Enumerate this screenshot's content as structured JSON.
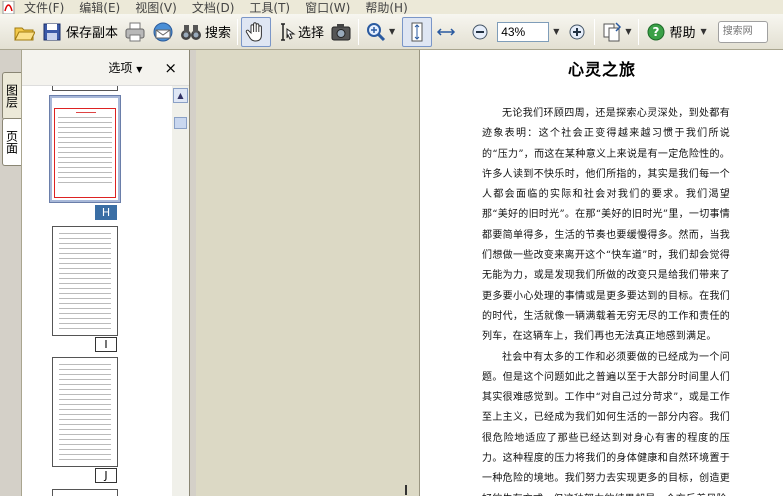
{
  "menu": [
    {
      "label": "文件(F)"
    },
    {
      "label": "编辑(E)"
    },
    {
      "label": "视图(V)"
    },
    {
      "label": "文档(D)"
    },
    {
      "label": "工具(T)"
    },
    {
      "label": "窗口(W)"
    },
    {
      "label": "帮助(H)"
    }
  ],
  "toolbar": {
    "save_copy": "保存副本",
    "search": "搜索",
    "select": "选择",
    "zoom_value": "43%",
    "help": "帮助",
    "search_placeholder": "搜索网"
  },
  "sidebar_tabs": {
    "layers": "图层",
    "pages": "页面"
  },
  "panel": {
    "options": "选项",
    "close": "×",
    "thumbnails": [
      {
        "label": "H",
        "selected": true
      },
      {
        "label": "I",
        "selected": false
      },
      {
        "label": "J",
        "selected": false
      }
    ]
  },
  "document": {
    "title": "心灵之旅",
    "paragraphs": [
      "无论我们环顾四周，还是探索心灵深处，到处都有迹象表明：这个社会正变得越来越习惯于我们所说的“压力”，而这在某种意义上来说是有一定危险性的。许多人读到不快乐时，他们所指的，其实是我们每一个人都会面临的实际和社会对我们的要求。我们渴望那“美好的旧时光”。在那“美好的旧时光”里，一切事情都要简单得多，生活的节奏也要缓慢得多。然而，当我们想做一些改变来离开这个“快车道”时，我们却会觉得无能为力，或是发现我们所做的改变只是给我们带来了更多要小心处理的事情或是更多要达到的目标。在我们的时代，生活就像一辆满载着无穷无尽的工作和责任的列车，在这辆车上，我们再也无法真正地感到满足。",
      "社会中有太多的工作和必须要做的已经成为一个问题。但是这个问题如此之普遍以至于大部分时间里人们其实很难感觉到。工作中“对自己过分苛求”，或是工作至上主义，已经成为我们如何生活的一部分内容。我们很危险地适应了那些已经达到对身心有害的程度的压力。这种程度的压力将我们的身体健康和自然环境置于一种危险的境地。我们努力去实现更多的目标，创造更好的生存方式，但这种努力的结果却是一个充斥着风险"
    ]
  },
  "colors": {
    "selection_blue": "#3a6ea5",
    "thumb_red_border": "#d22222",
    "doc_bg": "#dcd9c5"
  },
  "icons": [
    "pdf-app-icon",
    "open-folder-icon",
    "save-copy-icon",
    "print-icon",
    "email-icon",
    "binoculars-icon",
    "hand-tool-icon",
    "select-text-icon",
    "snapshot-icon",
    "zoom-in-tool-icon",
    "fit-page-icon",
    "fit-width-icon",
    "zoom-out-icon",
    "zoom-plus-icon",
    "page-layout-icon",
    "help-icon"
  ]
}
